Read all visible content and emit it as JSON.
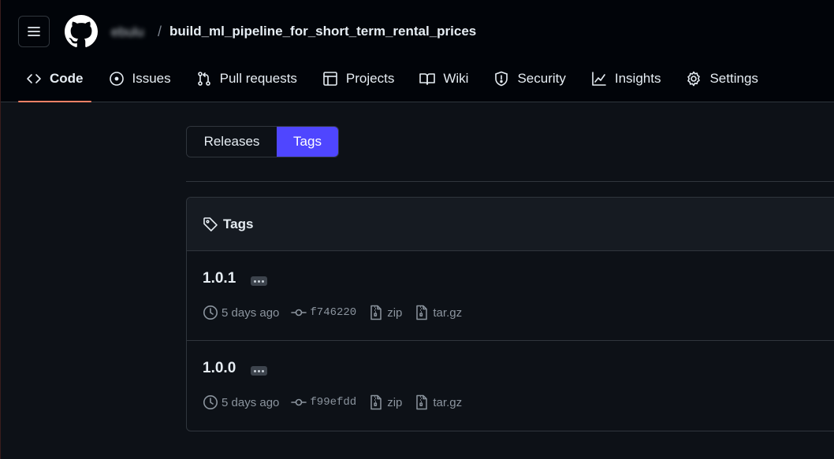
{
  "header": {
    "owner": "ebulu",
    "separator": "/",
    "repo_name": "build_ml_pipeline_for_short_term_rental_prices"
  },
  "nav": [
    {
      "label": "Code",
      "icon": "code-icon",
      "active": true
    },
    {
      "label": "Issues",
      "icon": "issue-icon"
    },
    {
      "label": "Pull requests",
      "icon": "pull-request-icon"
    },
    {
      "label": "Projects",
      "icon": "table-icon"
    },
    {
      "label": "Wiki",
      "icon": "book-icon"
    },
    {
      "label": "Security",
      "icon": "shield-icon"
    },
    {
      "label": "Insights",
      "icon": "graph-icon"
    },
    {
      "label": "Settings",
      "icon": "gear-icon"
    }
  ],
  "toggle": {
    "releases": "Releases",
    "tags": "Tags"
  },
  "tags_box": {
    "title": "Tags",
    "items": [
      {
        "name": "1.0.1",
        "age": "5 days ago",
        "commit": "f746220",
        "zip": "zip",
        "targz": "tar.gz"
      },
      {
        "name": "1.0.0",
        "age": "5 days ago",
        "commit": "f99efdd",
        "zip": "zip",
        "targz": "tar.gz"
      }
    ]
  },
  "colors": {
    "background": "#0d1117",
    "header_bg": "#010409",
    "accent_tab": "#f78166",
    "selected_toggle": "#4f46ff",
    "border": "#30363d",
    "muted_text": "#8b949e"
  }
}
